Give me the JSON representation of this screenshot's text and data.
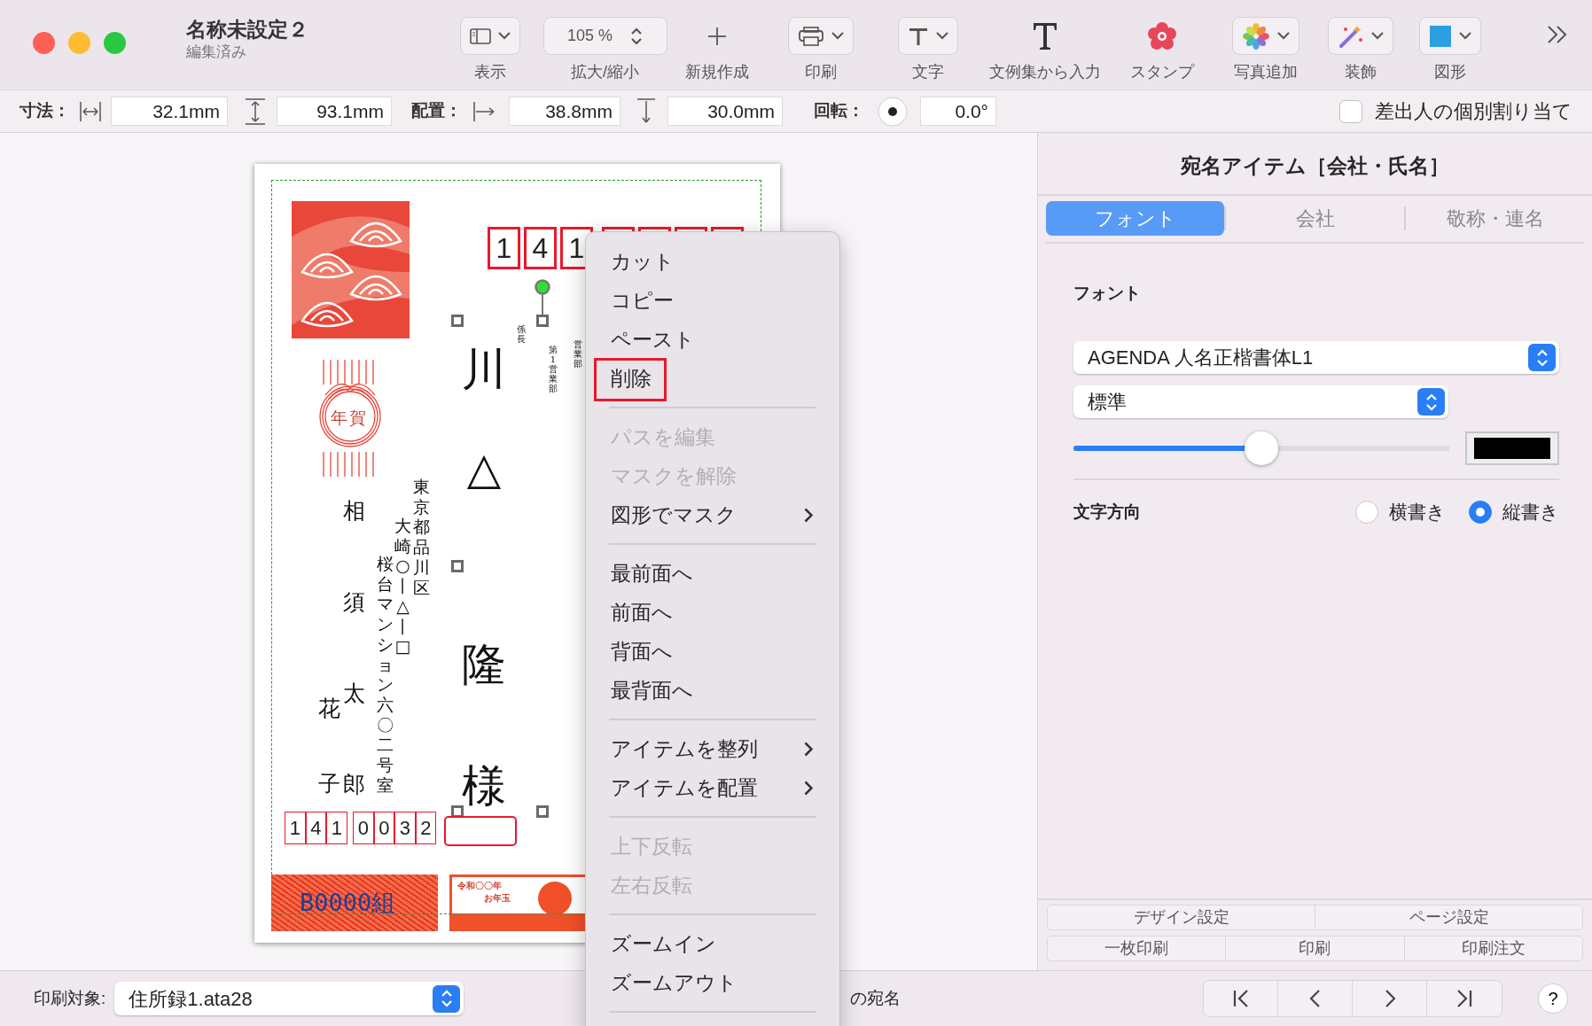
{
  "window": {
    "title": "名称未設定２",
    "subtitle": "編集済み"
  },
  "toolbar": [
    {
      "kind": "dropdown",
      "label": "表示"
    },
    {
      "kind": "stepper",
      "value": "105 %",
      "label": "拡大/縮小"
    },
    {
      "kind": "button",
      "label": "新規作成"
    },
    {
      "kind": "dropdown",
      "label": "印刷"
    },
    {
      "kind": "dropdown",
      "label": "文字"
    },
    {
      "kind": "button",
      "label": "文例集から入力"
    },
    {
      "kind": "button",
      "label": "スタンプ"
    },
    {
      "kind": "dropdown",
      "label": "写真追加"
    },
    {
      "kind": "dropdown",
      "label": "装飾"
    },
    {
      "kind": "dropdown",
      "label": "図形"
    }
  ],
  "item_bar": {
    "size_label": "寸法：",
    "width": "32.1mm",
    "height": "93.1mm",
    "position_label": "配置：",
    "x": "38.8mm",
    "y": "30.0mm",
    "rotation_label": "回転：",
    "rotation": "0.0°",
    "sender_assign": {
      "label": "差出人の個別割り当て",
      "checked": false
    }
  },
  "postcard": {
    "postal_code": [
      "1",
      "4",
      "1"
    ],
    "recipient": {
      "title": "係長",
      "department": "第1営業部",
      "department_2": "営業部",
      "family_name": "川△",
      "given_name": "隆",
      "honorific": "様"
    },
    "sender": {
      "address": [
        "東京都品川区",
        "大崎○丨△丨□",
        "桜台マンション六〇二号室"
      ],
      "names": [
        "花子",
        "相須太郎"
      ],
      "postal_code": [
        "1",
        "4",
        "1",
        "0",
        "0",
        "3",
        "2"
      ]
    },
    "nenga_mark": "年賀",
    "lottery": {
      "group": "B0000組",
      "era": "令和〇〇年",
      "prize": "お年玉"
    }
  },
  "context_menu": [
    {
      "kind": "item",
      "label": "カット",
      "disabled": false,
      "submenu": false,
      "highlighted": false
    },
    {
      "kind": "item",
      "label": "コピー",
      "disabled": false,
      "submenu": false,
      "highlighted": false
    },
    {
      "kind": "item",
      "label": "ペースト",
      "disabled": false,
      "submenu": false,
      "highlighted": false
    },
    {
      "kind": "item",
      "label": "削除",
      "disabled": false,
      "submenu": false,
      "highlighted": true
    },
    {
      "kind": "separator"
    },
    {
      "kind": "item",
      "label": "パスを編集",
      "disabled": true,
      "submenu": false,
      "highlighted": false
    },
    {
      "kind": "item",
      "label": "マスクを解除",
      "disabled": true,
      "submenu": false,
      "highlighted": false
    },
    {
      "kind": "item",
      "label": "図形でマスク",
      "disabled": false,
      "submenu": true,
      "highlighted": false
    },
    {
      "kind": "separator"
    },
    {
      "kind": "item",
      "label": "最前面へ",
      "disabled": false,
      "submenu": false,
      "highlighted": false
    },
    {
      "kind": "item",
      "label": "前面へ",
      "disabled": false,
      "submenu": false,
      "highlighted": false
    },
    {
      "kind": "item",
      "label": "背面へ",
      "disabled": false,
      "submenu": false,
      "highlighted": false
    },
    {
      "kind": "item",
      "label": "最背面へ",
      "disabled": false,
      "submenu": false,
      "highlighted": false
    },
    {
      "kind": "separator"
    },
    {
      "kind": "item",
      "label": "アイテムを整列",
      "disabled": false,
      "submenu": true,
      "highlighted": false
    },
    {
      "kind": "item",
      "label": "アイテムを配置",
      "disabled": false,
      "submenu": true,
      "highlighted": false
    },
    {
      "kind": "separator"
    },
    {
      "kind": "item",
      "label": "上下反転",
      "disabled": true,
      "submenu": false,
      "highlighted": false
    },
    {
      "kind": "item",
      "label": "左右反転",
      "disabled": true,
      "submenu": false,
      "highlighted": false
    },
    {
      "kind": "separator"
    },
    {
      "kind": "item",
      "label": "ズームイン",
      "disabled": false,
      "submenu": false,
      "highlighted": false
    },
    {
      "kind": "item",
      "label": "ズームアウト",
      "disabled": false,
      "submenu": false,
      "highlighted": false
    },
    {
      "kind": "separator"
    }
  ],
  "inspector": {
    "title": "宛名アイテム［会社・氏名］",
    "tabs": [
      {
        "label": "フォント",
        "selected": true
      },
      {
        "label": "会社",
        "selected": false
      },
      {
        "label": "敬称・連名",
        "selected": false
      }
    ],
    "font_label": "フォント",
    "font": "AGENDA 人名正楷書体L1",
    "style": "標準",
    "size_slider": {
      "level": 0.5
    },
    "direction_label": "文字方向",
    "direction_options": [
      {
        "label": "横書き",
        "selected": false
      },
      {
        "label": "縦書き",
        "selected": true
      }
    ],
    "buttons_row_1": [
      "デザイン設定",
      "ページ設定"
    ],
    "buttons_row_2": [
      "一枚印刷",
      "印刷",
      "印刷注文"
    ]
  },
  "bottom_bar": {
    "label": "印刷対象:",
    "target": "住所録1.ata28",
    "suffix": "の宛名",
    "help": "?"
  }
}
